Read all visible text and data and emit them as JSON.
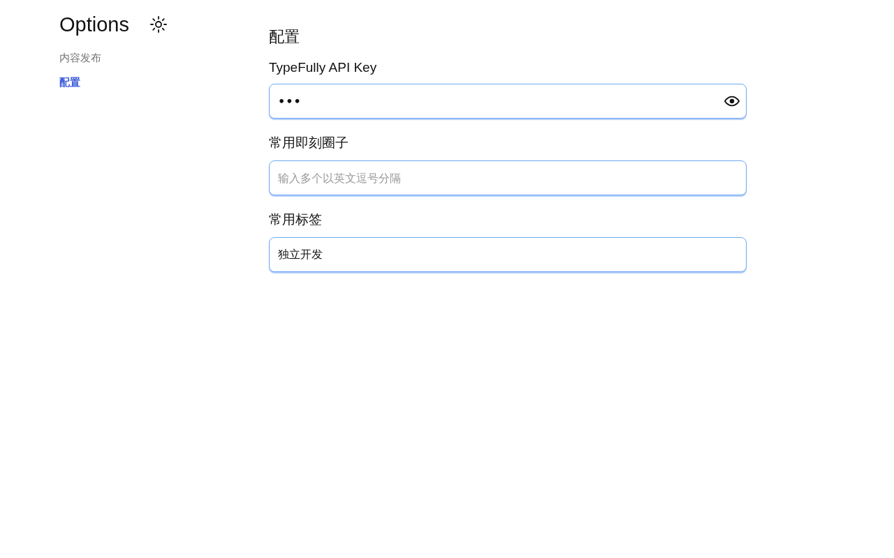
{
  "sidebar": {
    "title": "Options",
    "items": [
      {
        "label": "内容发布",
        "selected": false
      },
      {
        "label": "配置",
        "selected": true
      }
    ]
  },
  "main": {
    "heading": "配置",
    "fields": [
      {
        "kind": "password",
        "label": "TypeFully API Key",
        "value": "•••"
      },
      {
        "kind": "text",
        "label": "常用即刻圈子",
        "placeholder": "输入多个以英文逗号分隔"
      },
      {
        "kind": "text",
        "label": "常用标签",
        "value": "独立开发"
      }
    ]
  }
}
